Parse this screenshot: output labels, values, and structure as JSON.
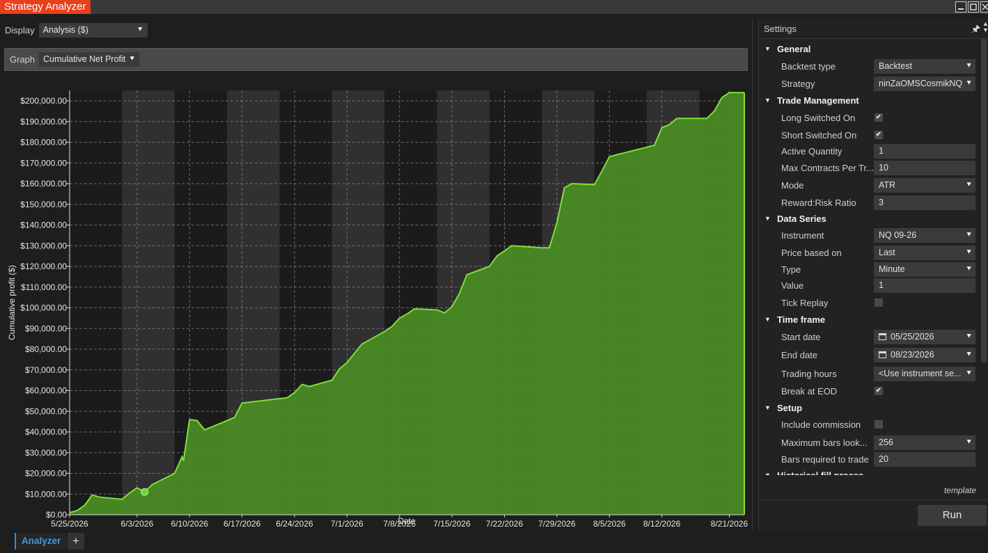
{
  "window": {
    "title": "Strategy Analyzer",
    "controls": [
      "minimize-icon",
      "maximize-icon",
      "close-icon"
    ]
  },
  "display": {
    "label": "Display",
    "value": "Analysis ($)"
  },
  "graph": {
    "label": "Graph",
    "value": "Cumulative Net Profit"
  },
  "settings": {
    "title": "Settings",
    "categories": [
      {
        "label": "General",
        "props": [
          {
            "label": "Backtest type",
            "kind": "select",
            "value": "Backtest"
          },
          {
            "label": "Strategy",
            "kind": "select",
            "value": "ninZaOMSCosmikNQ"
          }
        ]
      },
      {
        "label": "Trade Management",
        "props": [
          {
            "label": "Long Switched On",
            "kind": "check",
            "checked": true
          },
          {
            "label": "Short Switched On",
            "kind": "check",
            "checked": true
          },
          {
            "label": "Active Quantity",
            "kind": "text",
            "value": "1"
          },
          {
            "label": "Max Contracts Per Tr...",
            "kind": "text",
            "value": "10"
          },
          {
            "label": "Mode",
            "kind": "select",
            "value": "ATR"
          },
          {
            "label": "Reward:Risk Ratio",
            "kind": "text",
            "value": "3"
          }
        ]
      },
      {
        "label": "Data Series",
        "props": [
          {
            "label": "Instrument",
            "kind": "select",
            "value": "NQ 09-26"
          },
          {
            "label": "Price based on",
            "kind": "select",
            "value": "Last"
          },
          {
            "label": "Type",
            "kind": "select",
            "value": "Minute"
          },
          {
            "label": "Value",
            "kind": "text",
            "value": "1"
          },
          {
            "label": "Tick Replay",
            "kind": "check",
            "checked": false
          }
        ]
      },
      {
        "label": "Time frame",
        "props": [
          {
            "label": "Start date",
            "kind": "date",
            "value": "05/25/2026"
          },
          {
            "label": "End date",
            "kind": "date",
            "value": "08/23/2026"
          },
          {
            "label": "Trading hours",
            "kind": "select",
            "value": "<Use instrument se..."
          },
          {
            "label": "Break at EOD",
            "kind": "check",
            "checked": true
          }
        ]
      },
      {
        "label": "Setup",
        "props": [
          {
            "label": "Include commission",
            "kind": "check",
            "checked": false
          },
          {
            "label": "Maximum bars look...",
            "kind": "select",
            "value": "256"
          },
          {
            "label": "Bars required to trade",
            "kind": "text",
            "value": "20"
          }
        ]
      },
      {
        "label": "Historical fill proces",
        "props": []
      }
    ],
    "template_link": "template",
    "run_label": "Run"
  },
  "bottom": {
    "tab_label": "Analyzer",
    "add_tab": "+"
  },
  "colors": {
    "accent": "#e8401c",
    "area_fill": "#4a8a24",
    "line": "#7fe03a",
    "tab_blue": "#3a9be8"
  },
  "chart_data": {
    "type": "area",
    "title": "",
    "xlabel": "Date",
    "ylabel": "Cumulative profit ($)",
    "ylim": [
      0,
      200000
    ],
    "y_ticks": [
      "$0.00",
      "$10,000.00",
      "$20,000.00",
      "$30,000.00",
      "$40,000.00",
      "$50,000.00",
      "$60,000.00",
      "$70,000.00",
      "$80,000.00",
      "$90,000.00",
      "$100,000.00",
      "$110,000.00",
      "$120,000.00",
      "$130,000.00",
      "$140,000.00",
      "$150,000.00",
      "$160,000.00",
      "$170,000.00",
      "$180,000.00",
      "$190,000.00",
      "$200,000.00"
    ],
    "x_ticks": [
      "5/25/2026",
      "6/3/2026",
      "6/10/2026",
      "6/17/2026",
      "6/24/2026",
      "7/1/2026",
      "7/8/2026",
      "7/15/2026",
      "7/22/2026",
      "7/29/2026",
      "8/5/2026",
      "8/12/2026",
      "8/21/2026"
    ],
    "grid": true,
    "highlighted_point": {
      "x": "6/4/2026",
      "y": 11000
    },
    "series": [
      {
        "points": [
          [
            "5/25/2026",
            1000
          ],
          [
            "5/26/2026",
            2000
          ],
          [
            "5/27/2026",
            4500
          ],
          [
            "5/28/2026",
            9500
          ],
          [
            "5/29/2026",
            8500
          ],
          [
            "6/1/2026",
            7500
          ],
          [
            "6/2/2026",
            10500
          ],
          [
            "6/3/2026",
            13000
          ],
          [
            "6/4/2026",
            11000
          ],
          [
            "6/5/2026",
            14500
          ],
          [
            "6/8/2026",
            20000
          ],
          [
            "6/9/2026",
            28000
          ],
          [
            "6/9/2026",
            26000
          ],
          [
            "6/10/2026",
            46000
          ],
          [
            "6/11/2026",
            45500
          ],
          [
            "6/12/2026",
            41000
          ],
          [
            "6/16/2026",
            47000
          ],
          [
            "6/17/2026",
            54000
          ],
          [
            "6/23/2026",
            56500
          ],
          [
            "6/24/2026",
            59000
          ],
          [
            "6/25/2026",
            63000
          ],
          [
            "6/26/2026",
            62000
          ],
          [
            "6/29/2026",
            65000
          ],
          [
            "6/30/2026",
            70500
          ],
          [
            "7/1/2026",
            73500
          ],
          [
            "7/2/2026",
            78000
          ],
          [
            "7/3/2026",
            82500
          ],
          [
            "7/6/2026",
            88500
          ],
          [
            "7/7/2026",
            91000
          ],
          [
            "7/8/2026",
            95000
          ],
          [
            "7/9/2026",
            97000
          ],
          [
            "7/10/2026",
            99500
          ],
          [
            "7/13/2026",
            99000
          ],
          [
            "7/14/2026",
            97500
          ],
          [
            "7/15/2026",
            100500
          ],
          [
            "7/16/2026",
            107000
          ],
          [
            "7/17/2026",
            116000
          ],
          [
            "7/20/2026",
            120000
          ],
          [
            "7/21/2026",
            125000
          ],
          [
            "7/22/2026",
            127500
          ],
          [
            "7/23/2026",
            130000
          ],
          [
            "7/27/2026",
            129000
          ],
          [
            "7/28/2026",
            129000
          ],
          [
            "7/29/2026",
            141000
          ],
          [
            "7/30/2026",
            158000
          ],
          [
            "7/31/2026",
            160000
          ],
          [
            "8/3/2026",
            159500
          ],
          [
            "8/4/2026",
            166000
          ],
          [
            "8/5/2026",
            173000
          ],
          [
            "8/6/2026",
            174000
          ],
          [
            "8/11/2026",
            178500
          ],
          [
            "8/12/2026",
            187000
          ],
          [
            "8/13/2026",
            188500
          ],
          [
            "8/14/2026",
            191500
          ],
          [
            "8/18/2026",
            191500
          ],
          [
            "8/19/2026",
            195000
          ],
          [
            "8/20/2026",
            201500
          ],
          [
            "8/21/2026",
            204000
          ],
          [
            "8/23/2026",
            204000
          ]
        ]
      }
    ]
  }
}
